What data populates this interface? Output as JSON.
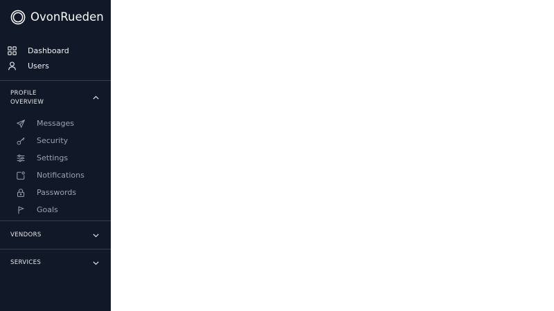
{
  "brand": {
    "name": "OvonRueden",
    "icon": "ring-logo-icon"
  },
  "colors": {
    "sidebar_bg": "#111827",
    "divider": "#374151",
    "text_primary": "#f3f4f6",
    "text_muted": "#9ca3af"
  },
  "nav": [
    {
      "label": "Dashboard",
      "icon": "grid-icon"
    },
    {
      "label": "Users",
      "icon": "user-icon"
    }
  ],
  "sections": [
    {
      "title_line1": "PROFILE",
      "title_line2": "OVERVIEW",
      "expanded": true,
      "items": [
        {
          "label": "Messages",
          "icon": "send-icon"
        },
        {
          "label": "Security",
          "icon": "key-icon"
        },
        {
          "label": "Settings",
          "icon": "sliders-icon"
        },
        {
          "label": "Notifications",
          "icon": "notification-icon"
        },
        {
          "label": "Passwords",
          "icon": "lock-icon"
        },
        {
          "label": "Goals",
          "icon": "flag-icon"
        }
      ]
    },
    {
      "title": "VENDORS",
      "expanded": false
    },
    {
      "title": "SERVICES",
      "expanded": false
    }
  ]
}
